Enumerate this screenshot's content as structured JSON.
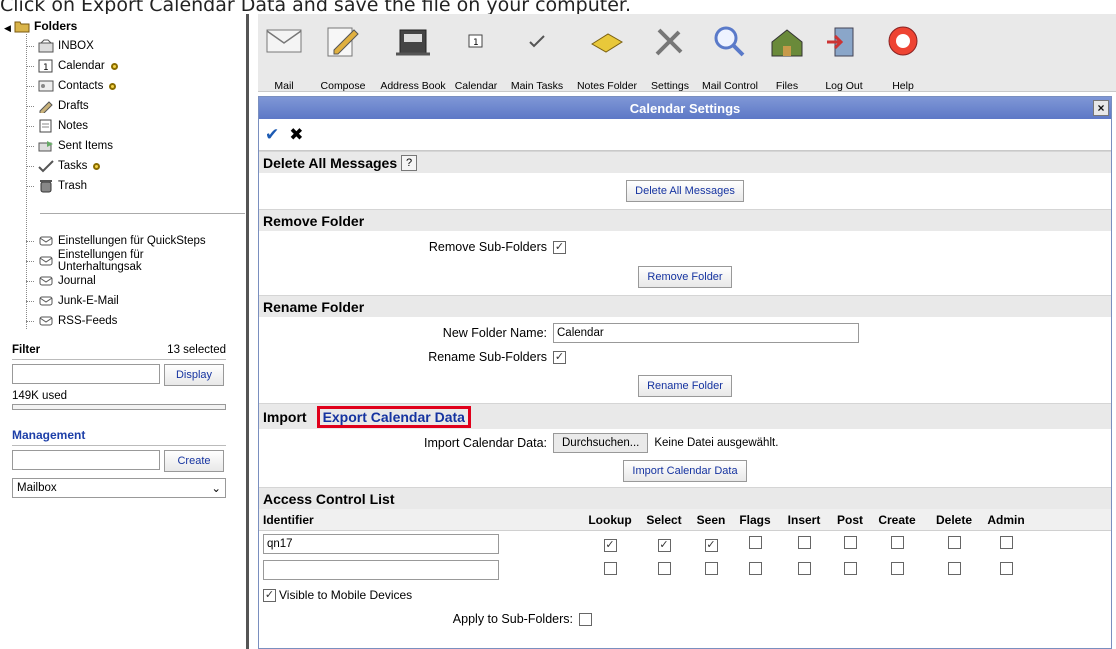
{
  "caption": "Click on Export Calendar Data and save the file on your computer.",
  "sidebar": {
    "root_label": "Folders",
    "folders": [
      {
        "label": "INBOX",
        "icon": "inbox-icon",
        "dot": false
      },
      {
        "label": "Calendar",
        "icon": "calendar-icon",
        "dot": true
      },
      {
        "label": "Contacts",
        "icon": "contacts-icon",
        "dot": true
      },
      {
        "label": "Drafts",
        "icon": "drafts-icon",
        "dot": false
      },
      {
        "label": "Notes",
        "icon": "notes-icon",
        "dot": false
      },
      {
        "label": "Sent Items",
        "icon": "sent-icon",
        "dot": false
      },
      {
        "label": "Tasks",
        "icon": "tasks-icon",
        "dot": true
      },
      {
        "label": "Trash",
        "icon": "trash-icon",
        "dot": false
      }
    ],
    "mail_folders": [
      "Einstellungen für QuickSteps",
      "Einstellungen für Unterhaltungsak",
      "Journal",
      "Junk-E-Mail",
      "RSS-Feeds"
    ],
    "filter": {
      "label": "Filter",
      "count": "13 selected",
      "value": "",
      "button": "Display"
    },
    "usage": "149K used",
    "management": {
      "label": "Management",
      "value": "",
      "button": "Create",
      "select_value": "Mailbox"
    }
  },
  "toolbar": {
    "items": [
      {
        "label": "Mail",
        "icon": "mail-icon"
      },
      {
        "label": "Compose",
        "icon": "compose-icon"
      },
      {
        "label": "Address Book",
        "icon": "address-book-icon"
      },
      {
        "label": "Calendar",
        "icon": "calendar-icon"
      },
      {
        "label": "Main Tasks",
        "icon": "tasks-icon"
      },
      {
        "label": "Notes Folder",
        "icon": "notes-icon"
      },
      {
        "label": "Settings",
        "icon": "settings-icon"
      },
      {
        "label": "Mail Control",
        "icon": "mail-control-icon"
      },
      {
        "label": "Files",
        "icon": "files-icon"
      },
      {
        "label": "Log Out",
        "icon": "logout-icon"
      },
      {
        "label": "Help",
        "icon": "help-icon"
      }
    ]
  },
  "dialog": {
    "title": "Calendar Settings",
    "delete_all": {
      "heading": "Delete All Messages",
      "help": "?",
      "button": "Delete All Messages"
    },
    "remove_folder": {
      "heading": "Remove Folder",
      "sub_label": "Remove Sub-Folders",
      "button": "Remove Folder"
    },
    "rename_folder": {
      "heading": "Rename Folder",
      "name_label": "New Folder Name:",
      "name_value": "Calendar",
      "sub_label": "Rename Sub-Folders",
      "button": "Rename Folder"
    },
    "import": {
      "heading": "Import",
      "export_link": "Export Calendar Data",
      "import_label": "Import Calendar Data:",
      "browse": "Durchsuchen...",
      "no_file": "Keine Datei ausgewählt.",
      "button": "Import Calendar Data"
    },
    "acl": {
      "heading": "Access Control List",
      "columns": [
        "Identifier",
        "Lookup",
        "Select",
        "Seen",
        "Flags",
        "Insert",
        "Post",
        "Create",
        "Delete",
        "Admin"
      ],
      "rows": [
        {
          "identifier": "qn17",
          "checks": [
            true,
            true,
            true,
            false,
            false,
            false,
            false,
            false,
            false
          ]
        },
        {
          "identifier": "",
          "checks": [
            false,
            false,
            false,
            false,
            false,
            false,
            false,
            false,
            false
          ]
        }
      ],
      "mobile_label": "Visible to Mobile Devices",
      "apply_label": "Apply to Sub-Folders:"
    }
  }
}
